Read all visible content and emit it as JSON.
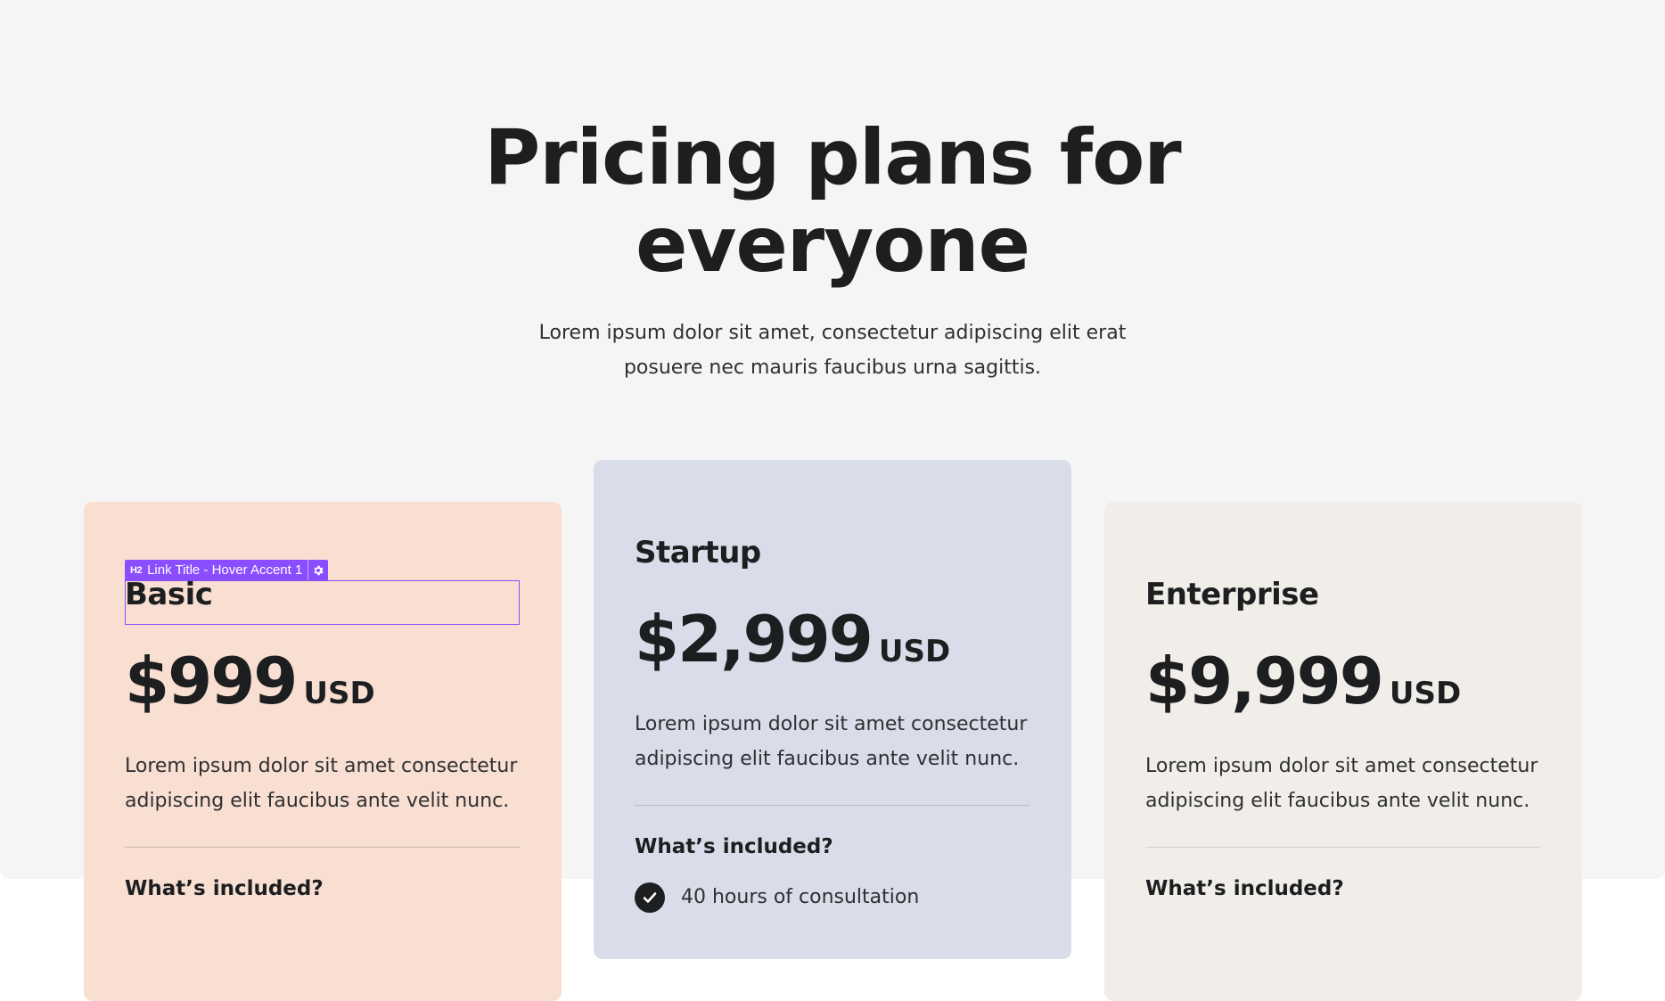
{
  "hero": {
    "title": "Pricing plans for everyone",
    "subtitle": "Lorem ipsum dolor sit amet, consectetur adipiscing elit erat posuere nec mauris faucibus urna sagittis."
  },
  "plans": [
    {
      "name": "Basic",
      "amount": "$999",
      "currency": "USD",
      "description": "Lorem ipsum dolor sit amet consectetur adipiscing elit faucibus ante velit nunc.",
      "included_heading": "What’s included?",
      "bg_color": "#f8dfd1"
    },
    {
      "name": "Startup",
      "amount": "$2,999",
      "currency": "USD",
      "description": "Lorem ipsum dolor sit amet consectetur adipiscing elit faucibus ante velit nunc.",
      "included_heading": "What’s included?",
      "features": [
        "40 hours of consultation"
      ],
      "bg_color": "#d9dde9"
    },
    {
      "name": "Enterprise",
      "amount": "$9,999",
      "currency": "USD",
      "description": "Lorem ipsum dolor sit amet consectetur adipiscing elit faucibus ante velit nunc.",
      "included_heading": "What’s included?",
      "bg_color": "#f1eeea"
    }
  ],
  "editor_overlay": {
    "tag_icon": "h2-icon",
    "tag_label": "Link Title - Hover Accent 1",
    "settings_icon": "gear-icon",
    "accent_color": "#8a4dff"
  },
  "icons": {
    "check": "check-circle-icon"
  }
}
